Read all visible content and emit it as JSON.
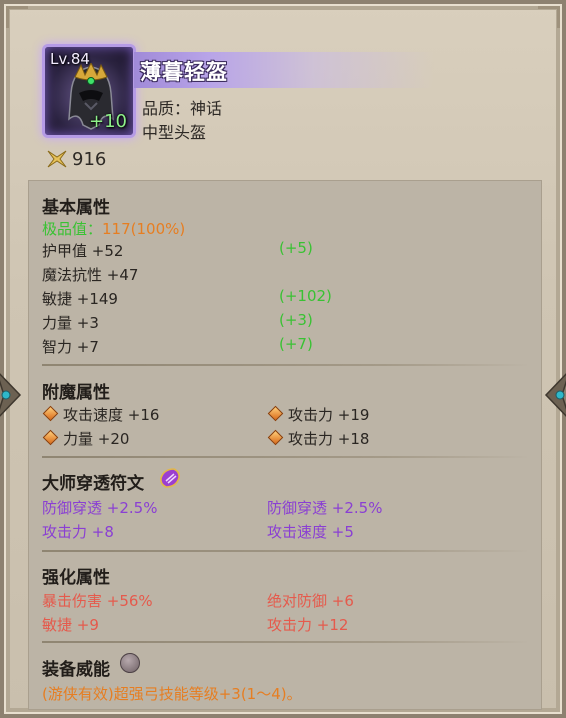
{
  "item": {
    "level_label": "Lv.84",
    "enhance_label": "+10",
    "name": "薄暮轻盔",
    "quality": "品质：神话",
    "type": "中型头盔",
    "gear_score": "916"
  },
  "base_stats": {
    "title": "基本属性",
    "perfection_label": "极品值：",
    "perfection_value": "117(100%)",
    "rows": [
      {
        "label": "护甲值 +52",
        "bonus": "(+5)"
      },
      {
        "label": "魔法抗性 +47",
        "bonus": ""
      },
      {
        "label": "敏捷 +149",
        "bonus": "(+102)"
      },
      {
        "label": "力量 +3",
        "bonus": "(+3)"
      },
      {
        "label": "智力 +7",
        "bonus": "(+7)"
      }
    ]
  },
  "enchant_stats": {
    "title": "附魔属性",
    "items": [
      "攻击速度 +16",
      "攻击力 +19",
      "力量 +20",
      "攻击力 +18"
    ]
  },
  "rune": {
    "title": "大师穿透符文",
    "items": [
      "防御穿透 +2.5%",
      "防御穿透 +2.5%",
      "攻击力 +8",
      "攻击速度 +5"
    ]
  },
  "enhance_stats": {
    "title": "强化属性",
    "items": [
      "暴击伤害 +56%",
      "绝对防御 +6",
      "敏捷 +9",
      "攻击力 +12"
    ]
  },
  "power": {
    "title": "装备威能",
    "text": "(游侠有效)超强弓技能等级+3(1～4)。"
  },
  "colors": {
    "green": "#39c233",
    "orange": "#e67e22",
    "purple": "#8a3fd3",
    "red": "#e55a4c",
    "mythic_frame": "#b59be6"
  },
  "icons": [
    "helmet-icon",
    "gear-score-icon",
    "enchant-diamond-icon",
    "rune-icon",
    "power-stone-icon"
  ]
}
